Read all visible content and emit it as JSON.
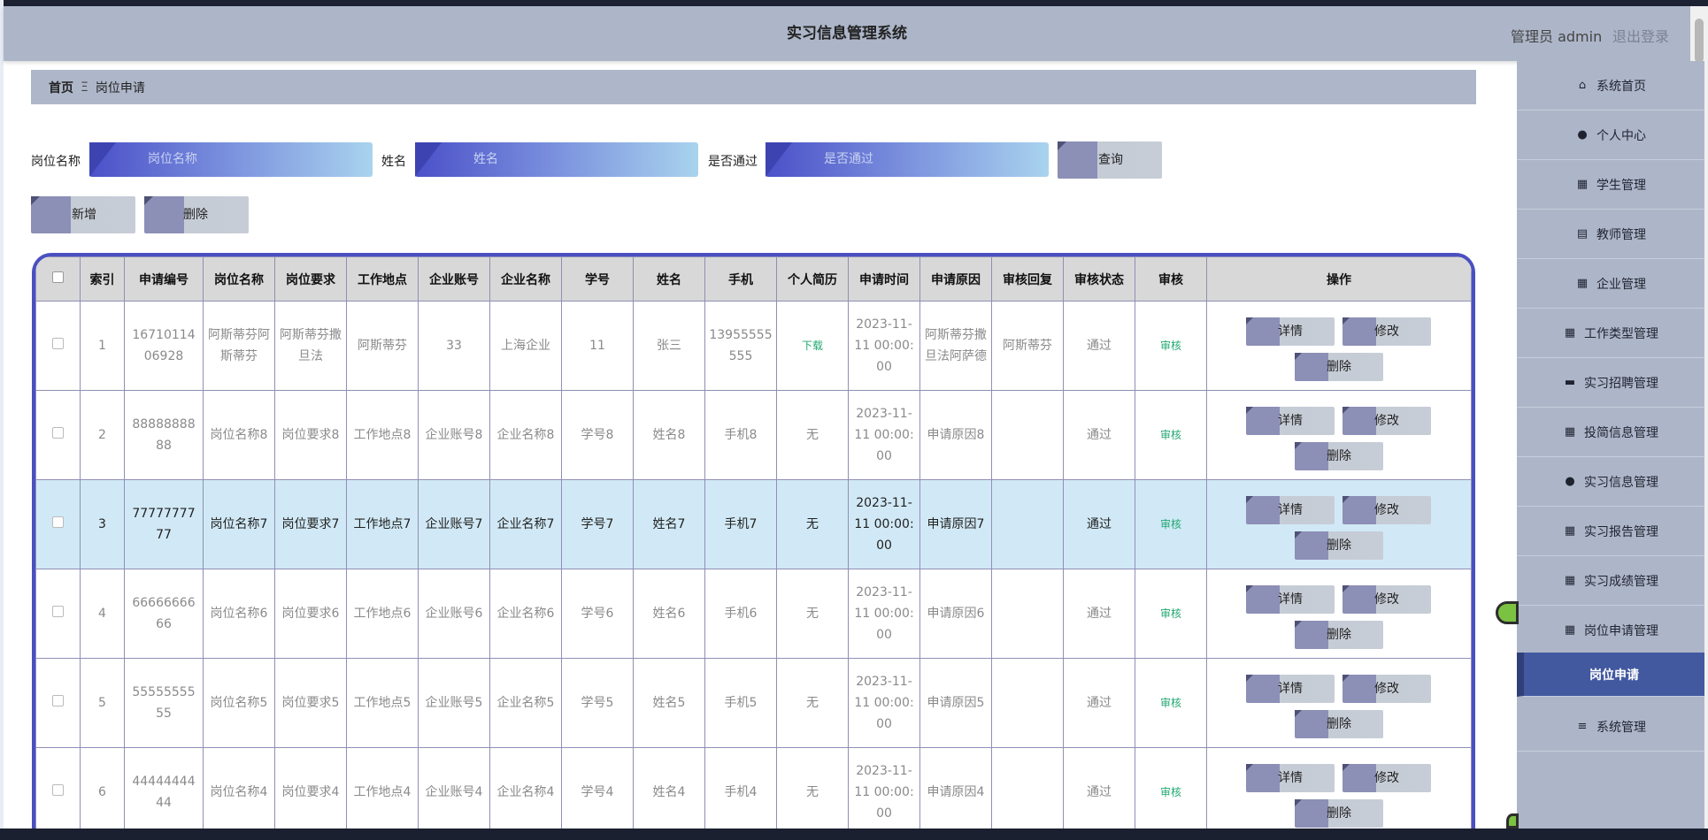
{
  "header": {
    "title": "实习信息管理系统",
    "admin": "管理员 admin",
    "logout": "退出登录"
  },
  "breadcrumb": {
    "home": "首页",
    "separator": "Ξ",
    "current": "岗位申请"
  },
  "search": {
    "fields": [
      {
        "label": "岗位名称",
        "placeholder": "岗位名称"
      },
      {
        "label": "姓名",
        "placeholder": "姓名"
      },
      {
        "label": "是否通过",
        "placeholder": "是否通过"
      }
    ],
    "query_label": "查询"
  },
  "actions": {
    "add_label": "新增",
    "delete_label": "删除"
  },
  "sidebar": {
    "items": [
      {
        "label": "系统首页",
        "icon": "home-icon"
      },
      {
        "label": "个人中心",
        "icon": "user-icon"
      },
      {
        "label": "学生管理",
        "icon": "grid-icon"
      },
      {
        "label": "教师管理",
        "icon": "clipboard-icon"
      },
      {
        "label": "企业管理",
        "icon": "grid-icon"
      },
      {
        "label": "工作类型管理",
        "icon": "grid-icon"
      },
      {
        "label": "实习招聘管理",
        "icon": "printer-icon"
      },
      {
        "label": "投简信息管理",
        "icon": "grid-icon"
      },
      {
        "label": "实习信息管理",
        "icon": "lightbulb-icon"
      },
      {
        "label": "实习报告管理",
        "icon": "grid-icon"
      },
      {
        "label": "实习成绩管理",
        "icon": "grid-icon"
      },
      {
        "label": "岗位申请管理",
        "icon": "grid-icon"
      },
      {
        "label": "岗位申请",
        "icon": ""
      },
      {
        "label": "系统管理",
        "icon": "sliders-icon"
      }
    ]
  },
  "table": {
    "columns": [
      "",
      "索引",
      "申请编号",
      "岗位名称",
      "岗位要求",
      "工作地点",
      "企业账号",
      "企业名称",
      "学号",
      "姓名",
      "手机",
      "个人简历",
      "申请时间",
      "申请原因",
      "审核回复",
      "审核状态",
      "审核",
      "操作"
    ],
    "op_labels": {
      "detail": "详情",
      "edit": "修改",
      "delete": "删除"
    },
    "rows": [
      {
        "index": "1",
        "app_no": "1671011406928",
        "post": "阿斯蒂芬阿斯蒂芬",
        "req": "阿斯蒂芬撒旦法",
        "place": "阿斯蒂芬",
        "account": "33",
        "company": "上海企业",
        "student_no": "11",
        "name": "张三",
        "phone": "13955555555",
        "resume": "下载",
        "time": "2023-11-11 00:00:00",
        "reason": "阿斯蒂芬撒旦法阿萨德",
        "reply": "阿斯蒂芬",
        "status": "通过",
        "audit": "审核"
      },
      {
        "index": "2",
        "app_no": "8888888888",
        "post": "岗位名称8",
        "req": "岗位要求8",
        "place": "工作地点8",
        "account": "企业账号8",
        "company": "企业名称8",
        "student_no": "学号8",
        "name": "姓名8",
        "phone": "手机8",
        "resume": "无",
        "time": "2023-11-11 00:00:00",
        "reason": "申请原因8",
        "reply": "",
        "status": "通过",
        "audit": "审核"
      },
      {
        "index": "3",
        "app_no": "7777777777",
        "post": "岗位名称7",
        "req": "岗位要求7",
        "place": "工作地点7",
        "account": "企业账号7",
        "company": "企业名称7",
        "student_no": "学号7",
        "name": "姓名7",
        "phone": "手机7",
        "resume": "无",
        "time": "2023-11-11 00:00:00",
        "reason": "申请原因7",
        "reply": "",
        "status": "通过",
        "audit": "审核"
      },
      {
        "index": "4",
        "app_no": "6666666666",
        "post": "岗位名称6",
        "req": "岗位要求6",
        "place": "工作地点6",
        "account": "企业账号6",
        "company": "企业名称6",
        "student_no": "学号6",
        "name": "姓名6",
        "phone": "手机6",
        "resume": "无",
        "time": "2023-11-11 00:00:00",
        "reason": "申请原因6",
        "reply": "",
        "status": "通过",
        "audit": "审核"
      },
      {
        "index": "5",
        "app_no": "5555555555",
        "post": "岗位名称5",
        "req": "岗位要求5",
        "place": "工作地点5",
        "account": "企业账号5",
        "company": "企业名称5",
        "student_no": "学号5",
        "name": "姓名5",
        "phone": "手机5",
        "resume": "无",
        "time": "2023-11-11 00:00:00",
        "reason": "申请原因5",
        "reply": "",
        "status": "通过",
        "audit": "审核"
      },
      {
        "index": "6",
        "app_no": "4444444444",
        "post": "岗位名称4",
        "req": "岗位要求4",
        "place": "工作地点4",
        "account": "企业账号4",
        "company": "企业名称4",
        "student_no": "学号4",
        "name": "姓名4",
        "phone": "手机4",
        "resume": "无",
        "time": "2023-11-11 00:00:00",
        "reason": "申请原因4",
        "reply": "",
        "status": "通过",
        "audit": "审核"
      }
    ]
  }
}
